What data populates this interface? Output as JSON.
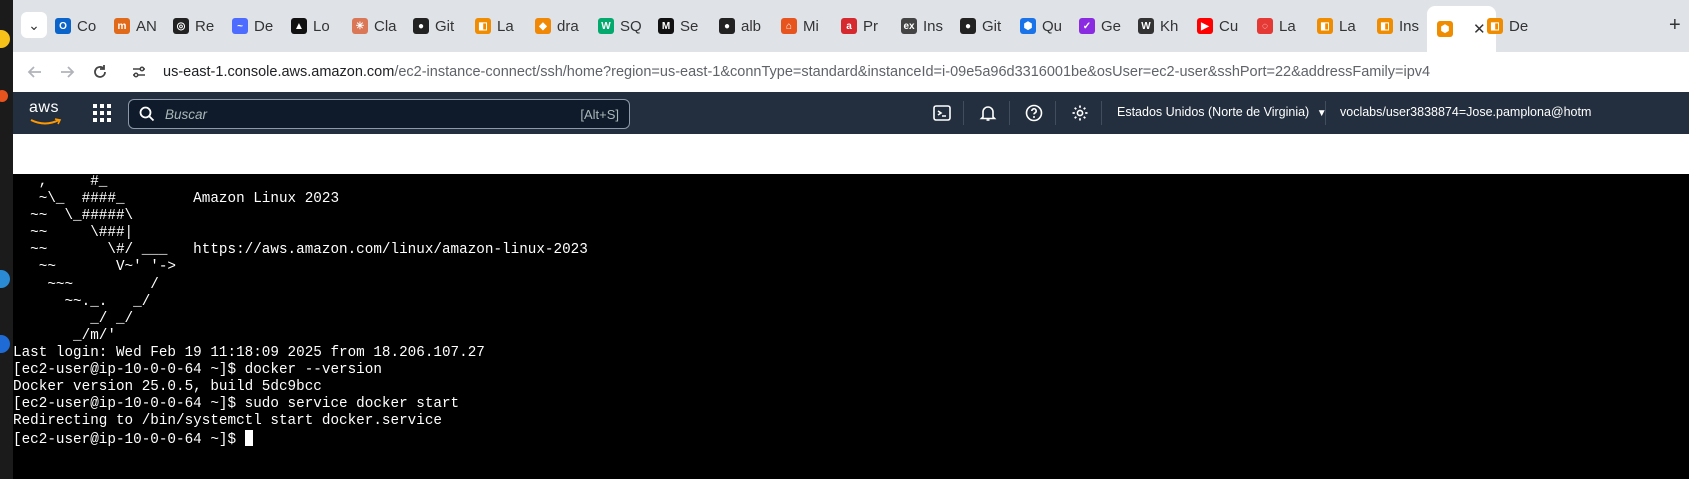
{
  "browser": {
    "tabs": [
      {
        "label": "Co",
        "icon": "outlook-icon",
        "color": "#0a64c9"
      },
      {
        "label": "AN",
        "icon": "m-icon",
        "color": "#e06a1a"
      },
      {
        "label": "Re",
        "icon": "openai-icon",
        "color": "#222222"
      },
      {
        "label": "De",
        "icon": "deepseek-icon",
        "color": "#4d6bfe"
      },
      {
        "label": "Lo",
        "icon": "triangle-icon",
        "color": "#111111"
      },
      {
        "label": "Cla",
        "icon": "claude-icon",
        "color": "#d97757"
      },
      {
        "label": "Git",
        "icon": "github-icon",
        "color": "#222222"
      },
      {
        "label": "La",
        "icon": "lab-icon",
        "color": "#f08c00"
      },
      {
        "label": "dra",
        "icon": "drawio-icon",
        "color": "#f08705"
      },
      {
        "label": "SQ",
        "icon": "w3-icon",
        "color": "#04aa6d"
      },
      {
        "label": "Se",
        "icon": "mo-icon",
        "color": "#111111"
      },
      {
        "label": "alb",
        "icon": "github-icon",
        "color": "#222222"
      },
      {
        "label": "Mi",
        "icon": "mi-icon",
        "color": "#e8541e"
      },
      {
        "label": "Pr",
        "icon": "a-icon",
        "color": "#d6282f"
      },
      {
        "label": "Ins",
        "icon": "ex-icon",
        "color": "#444444"
      },
      {
        "label": "Git",
        "icon": "github-icon",
        "color": "#222222"
      },
      {
        "label": "Qu",
        "icon": "cube-icon",
        "color": "#1a73e8"
      },
      {
        "label": "Ge",
        "icon": "check-icon",
        "color": "#8a2be2"
      },
      {
        "label": "Kh",
        "icon": "khan-icon",
        "color": "#333333"
      },
      {
        "label": "Cu",
        "icon": "youtube-icon",
        "color": "#ff0000"
      },
      {
        "label": "La",
        "icon": "ring-icon",
        "color": "#e53935"
      },
      {
        "label": "La",
        "icon": "lab-icon",
        "color": "#f08c00"
      },
      {
        "label": "Ins",
        "icon": "lab-icon",
        "color": "#f08c00"
      },
      {
        "label": "",
        "icon": "aws-cube-icon",
        "color": "#f08c00",
        "active": true
      },
      {
        "label": "De",
        "icon": "lab-icon",
        "color": "#f08c00"
      }
    ],
    "new_tab_label": "+",
    "chevron_label": "⌄",
    "close_label": "✕",
    "url_host": "us-east-1.console.aws.amazon.com",
    "url_path": "/ec2-instance-connect/ssh/home?region=us-east-1&connType=standard&instanceId=i-09e5a96d3316001be&osUser=ec2-user&sshPort=22&addressFamily=ipv4"
  },
  "aws": {
    "logo_text": "aws",
    "search_placeholder": "Buscar",
    "search_shortcut": "[Alt+S]",
    "region": "Estados Unidos (Norte de Virginia)",
    "user": "voclabs/user3838874=Jose.pamplona@hotm"
  },
  "terminal": {
    "lines": [
      "   ,     #_",
      "   ~\\_  ####_        Amazon Linux 2023",
      "  ~~  \\_#####\\",
      "  ~~     \\###|",
      "  ~~       \\#/ ___   https://aws.amazon.com/linux/amazon-linux-2023",
      "   ~~       V~' '->",
      "    ~~~         /",
      "      ~~._.   _/",
      "         _/ _/",
      "       _/m/'",
      "Last login: Wed Feb 19 11:18:09 2025 from 18.206.107.27",
      "[ec2-user@ip-10-0-0-64 ~]$ docker --version",
      "Docker version 25.0.5, build 5dc9bcc",
      "[ec2-user@ip-10-0-0-64 ~]$ sudo service docker start",
      "Redirecting to /bin/systemctl start docker.service"
    ],
    "prompt": "[ec2-user@ip-10-0-0-64 ~]$ "
  }
}
